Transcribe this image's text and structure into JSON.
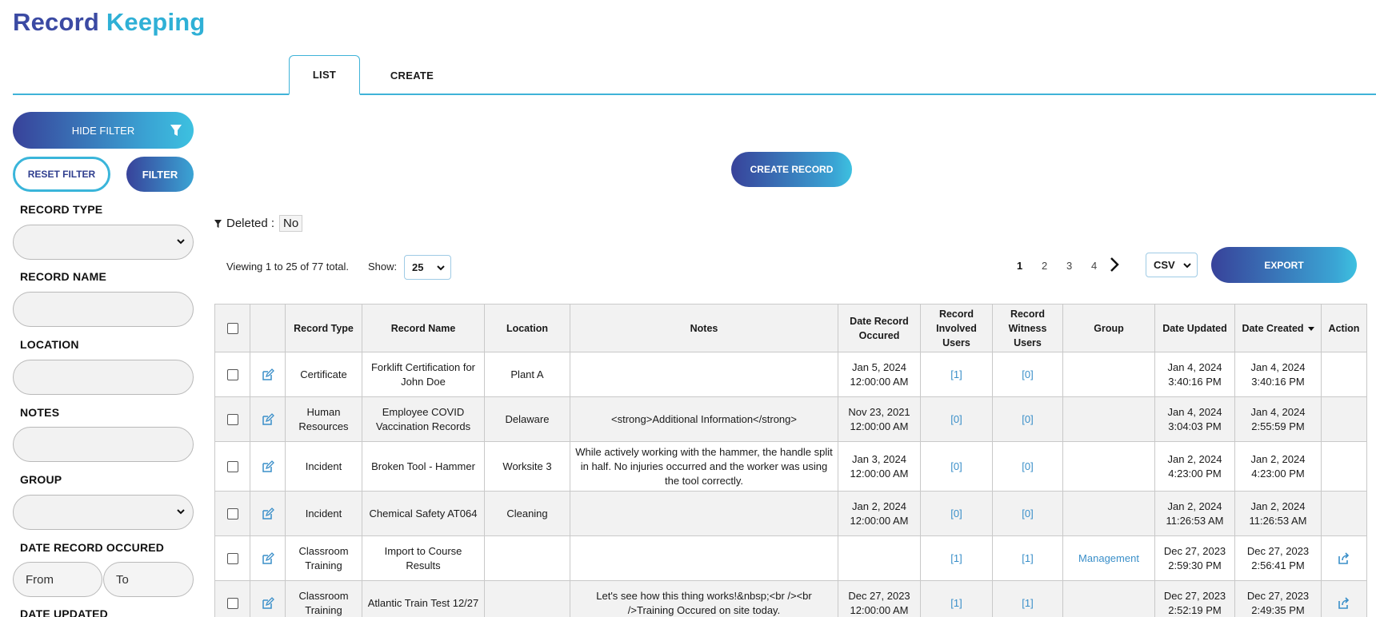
{
  "app": {
    "title_part1": "Record",
    "title_part2": "Keeping"
  },
  "tabs": [
    {
      "label": "LIST",
      "active": true
    },
    {
      "label": "CREATE",
      "active": false
    }
  ],
  "sidebar": {
    "hide_filter_label": "HIDE FILTER",
    "reset_filter_label": "RESET FILTER",
    "filter_label": "FILTER",
    "fields": {
      "record_type": "RECORD TYPE",
      "record_name": "RECORD NAME",
      "location": "LOCATION",
      "notes": "NOTES",
      "group": "GROUP",
      "date_record_occured": "DATE RECORD OCCURED",
      "date_from_placeholder": "From",
      "date_to_placeholder": "To",
      "date_updated": "DATE UPDATED"
    }
  },
  "main": {
    "create_record_label": "CREATE RECORD",
    "deleted_label": "Deleted :",
    "deleted_value": "No",
    "viewing_text": "Viewing 1 to 25 of 77 total.",
    "show_label": "Show:",
    "show_value": "25",
    "pages": [
      "1",
      "2",
      "3",
      "4"
    ],
    "current_page": "1",
    "export_format": "CSV",
    "export_label": "EXPORT"
  },
  "table": {
    "headers": {
      "record_type": "Record Type",
      "record_name": "Record Name",
      "location": "Location",
      "notes": "Notes",
      "date_occured": "Date Record Occured",
      "involved": "Record Involved Users",
      "witness": "Record Witness Users",
      "group": "Group",
      "date_updated": "Date Updated",
      "date_created": "Date Created",
      "action": "Action"
    },
    "rows": [
      {
        "type": "Certificate",
        "name": "Forklift Certification for John Doe",
        "location": "Plant A",
        "notes": "",
        "occured": "Jan 5, 2024 12:00:00 AM",
        "involved": "[1]",
        "witness": "[0]",
        "group": "",
        "updated": "Jan 4, 2024 3:40:16 PM",
        "created": "Jan 4, 2024 3:40:16 PM",
        "share": false
      },
      {
        "type": "Human Resources",
        "name": "Employee COVID Vaccination Records",
        "location": "Delaware",
        "notes": "<strong>Additional Information</strong>",
        "occured": "Nov 23, 2021 12:00:00 AM",
        "involved": "[0]",
        "witness": "[0]",
        "group": "",
        "updated": "Jan 4, 2024 3:04:03 PM",
        "created": "Jan 4, 2024 2:55:59 PM",
        "share": false
      },
      {
        "type": "Incident",
        "name": "Broken Tool - Hammer",
        "location": "Worksite 3",
        "notes": "While actively working with the hammer, the handle split in half. No injuries occurred and the worker was using the tool correctly.",
        "occured": "Jan 3, 2024 12:00:00 AM",
        "involved": "[0]",
        "witness": "[0]",
        "group": "",
        "updated": "Jan 2, 2024 4:23:00 PM",
        "created": "Jan 2, 2024 4:23:00 PM",
        "share": false
      },
      {
        "type": "Incident",
        "name": "Chemical Safety AT064",
        "location": "Cleaning",
        "notes": "",
        "occured": "Jan 2, 2024 12:00:00 AM",
        "involved": "[0]",
        "witness": "[0]",
        "group": "",
        "updated": "Jan 2, 2024 11:26:53 AM",
        "created": "Jan 2, 2024 11:26:53 AM",
        "share": false
      },
      {
        "type": "Classroom Training",
        "name": "Import to Course Results",
        "location": "",
        "notes": "",
        "occured": "",
        "involved": "[1]",
        "witness": "[1]",
        "group": "Management",
        "updated": "Dec 27, 2023 2:59:30 PM",
        "created": "Dec 27, 2023 2:56:41 PM",
        "share": true
      },
      {
        "type": "Classroom Training",
        "name": "Atlantic Train Test 12/27",
        "location": "",
        "notes": "Let's see how this thing works!&nbsp;<br /><br />Training Occured on site today.",
        "occured": "Dec 27, 2023 12:00:00 AM",
        "involved": "[1]",
        "witness": "[1]",
        "group": "",
        "updated": "Dec 27, 2023 2:52:19 PM",
        "created": "Dec 27, 2023 2:49:35 PM",
        "share": true
      }
    ]
  },
  "icons": {
    "filter": "funnel-icon",
    "chevron": "chevron-down-icon",
    "next": "chevron-right-icon",
    "edit": "edit-icon",
    "share": "share-icon",
    "sort": "sort-desc-icon"
  },
  "colors": {
    "brand_dark": "#38429a",
    "brand_light": "#3dc1e0",
    "link": "#3a8fc9"
  }
}
